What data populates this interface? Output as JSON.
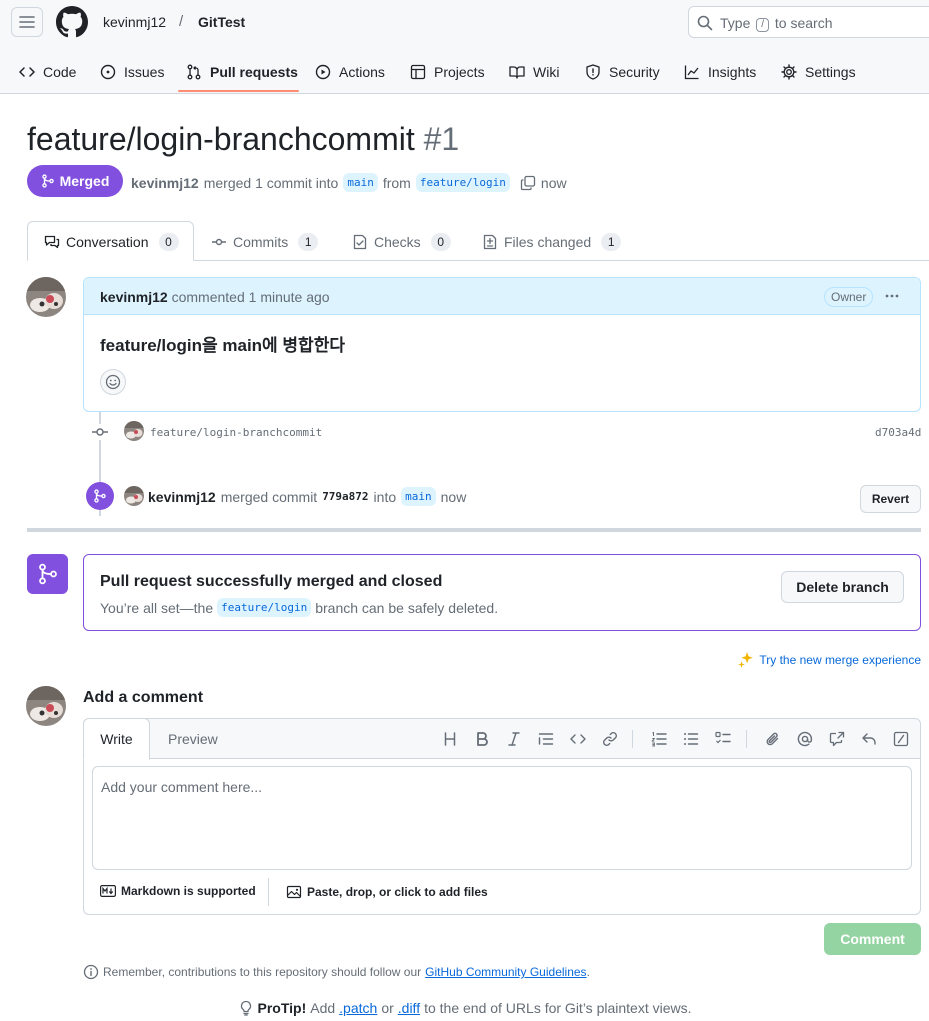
{
  "header": {
    "owner": "kevinmj12",
    "separator": "/",
    "repo": "GitTest",
    "search_prefix": "Type",
    "search_key": "/",
    "search_suffix": "to search"
  },
  "nav_tabs": [
    {
      "label": "Code",
      "icon": "code-icon"
    },
    {
      "label": "Issues",
      "icon": "issue-icon"
    },
    {
      "label": "Pull requests",
      "icon": "pull-request-icon",
      "active": true
    },
    {
      "label": "Actions",
      "icon": "play-icon"
    },
    {
      "label": "Projects",
      "icon": "table-icon"
    },
    {
      "label": "Wiki",
      "icon": "book-icon"
    },
    {
      "label": "Security",
      "icon": "shield-icon"
    },
    {
      "label": "Insights",
      "icon": "graph-icon"
    },
    {
      "label": "Settings",
      "icon": "gear-icon"
    }
  ],
  "pr": {
    "title": "feature/login-branchcommit",
    "number": "#1",
    "state": "Merged",
    "author": "kevinmj12",
    "merged_text": "merged 1 commit into",
    "base_branch": "main",
    "from_text": "from",
    "head_branch": "feature/login",
    "time": "now"
  },
  "pr_tabs": [
    {
      "label": "Conversation",
      "count": "0",
      "icon": "comment-discussion-icon",
      "active": true
    },
    {
      "label": "Commits",
      "count": "1",
      "icon": "commit-icon"
    },
    {
      "label": "Checks",
      "count": "0",
      "icon": "checklist-icon"
    },
    {
      "label": "Files changed",
      "count": "1",
      "icon": "file-diff-icon"
    }
  ],
  "comment": {
    "author": "kevinmj12",
    "action": "commented 1 minute ago",
    "role": "Owner",
    "body": "feature/login을 main에 병합한다"
  },
  "timeline": {
    "commit_message": "feature/login-branchcommit",
    "commit_sha": "d703a4d",
    "merge_author": "kevinmj12",
    "merge_text": "merged commit",
    "merge_sha": "779a872",
    "into_text": "into",
    "merge_branch": "main",
    "merge_time": "now",
    "revert_label": "Revert"
  },
  "merged_box": {
    "title": "Pull request successfully merged and closed",
    "sub_prefix": "You’re all set—the",
    "branch": "feature/login",
    "sub_suffix": "branch can be safely deleted.",
    "delete_label": "Delete branch"
  },
  "try_merge": "Try the new merge experience",
  "add_comment": {
    "title": "Add a comment",
    "write_tab": "Write",
    "preview_tab": "Preview",
    "placeholder": "Add your comment here...",
    "markdown_note": "Markdown is supported",
    "files_note": "Paste, drop, or click to add files",
    "submit_label": "Comment"
  },
  "footer": {
    "remember_prefix": "Remember, contributions to this repository should follow our",
    "guidelines_link": "GitHub Community Guidelines",
    "remember_suffix": ".",
    "protip_label": "ProTip!",
    "protip_add": "Add",
    "patch_link": ".patch",
    "or_text": "or",
    "diff_link": ".diff",
    "protip_suffix": "to the end of URLs for Git’s plaintext views."
  },
  "colors": {
    "merged_purple": "#8250df",
    "link_blue": "#0969da",
    "active_tab_underline": "#fd8c73",
    "comment_button_disabled": "#94d3a2"
  }
}
